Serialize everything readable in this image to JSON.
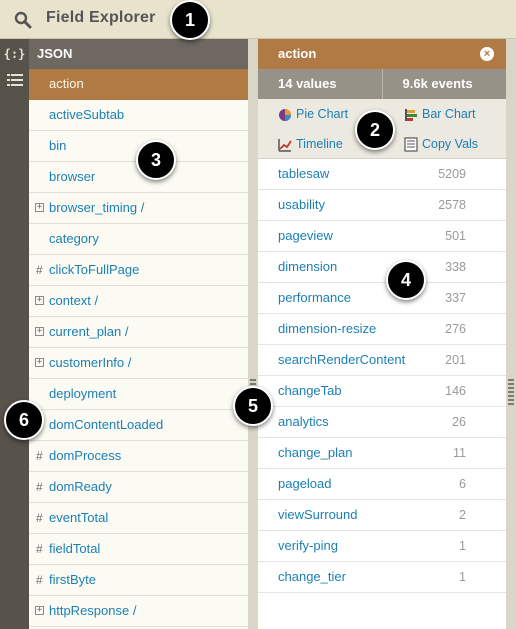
{
  "header": {
    "title": "Field Explorer"
  },
  "toolbar": {
    "json_tool": "{:}"
  },
  "left_panel": {
    "title": "JSON",
    "items": [
      {
        "label": "action",
        "prefix": "",
        "selected": true
      },
      {
        "label": "activeSubtab",
        "prefix": ""
      },
      {
        "label": "bin",
        "prefix": ""
      },
      {
        "label": "browser",
        "prefix": ""
      },
      {
        "label": "browser_timing /",
        "prefix": "+"
      },
      {
        "label": "category",
        "prefix": ""
      },
      {
        "label": "clickToFullPage",
        "prefix": "#"
      },
      {
        "label": "context /",
        "prefix": "+"
      },
      {
        "label": "current_plan /",
        "prefix": "+"
      },
      {
        "label": "customerInfo /",
        "prefix": "+"
      },
      {
        "label": "deployment",
        "prefix": ""
      },
      {
        "label": "domContentLoaded",
        "prefix": ""
      },
      {
        "label": "domProcess",
        "prefix": "#"
      },
      {
        "label": "domReady",
        "prefix": "#"
      },
      {
        "label": "eventTotal",
        "prefix": "#"
      },
      {
        "label": "fieldTotal",
        "prefix": "#"
      },
      {
        "label": "firstByte",
        "prefix": "#"
      },
      {
        "label": "httpResponse /",
        "prefix": "+"
      }
    ]
  },
  "right_panel": {
    "title": "action",
    "values_count": "14 values",
    "events_count": "9.6k events",
    "actions": {
      "pie_chart": "Pie Chart",
      "bar_chart": "Bar Chart",
      "timeline": "Timeline",
      "copy_vals": "Copy Vals"
    },
    "rows": [
      {
        "value": "tablesaw",
        "count": "5209"
      },
      {
        "value": "usability",
        "count": "2578"
      },
      {
        "value": "pageview",
        "count": "501"
      },
      {
        "value": "dimension",
        "count": "338"
      },
      {
        "value": "performance",
        "count": "337"
      },
      {
        "value": "dimension-resize",
        "count": "276"
      },
      {
        "value": "searchRenderContent",
        "count": "201"
      },
      {
        "value": "changeTab",
        "count": "146"
      },
      {
        "value": "analytics",
        "count": "26"
      },
      {
        "value": "change_plan",
        "count": "11"
      },
      {
        "value": "pageload",
        "count": "6"
      },
      {
        "value": "viewSurround",
        "count": "2"
      },
      {
        "value": "verify-ping",
        "count": "1"
      },
      {
        "value": "change_tier",
        "count": "1"
      }
    ]
  },
  "callouts": [
    "1",
    "2",
    "3",
    "4",
    "5",
    "6"
  ],
  "colors": {
    "accent": "#b07a45",
    "link": "#1c7fb5",
    "header_bg": "#e7e3cc",
    "dark": "#57524a"
  }
}
